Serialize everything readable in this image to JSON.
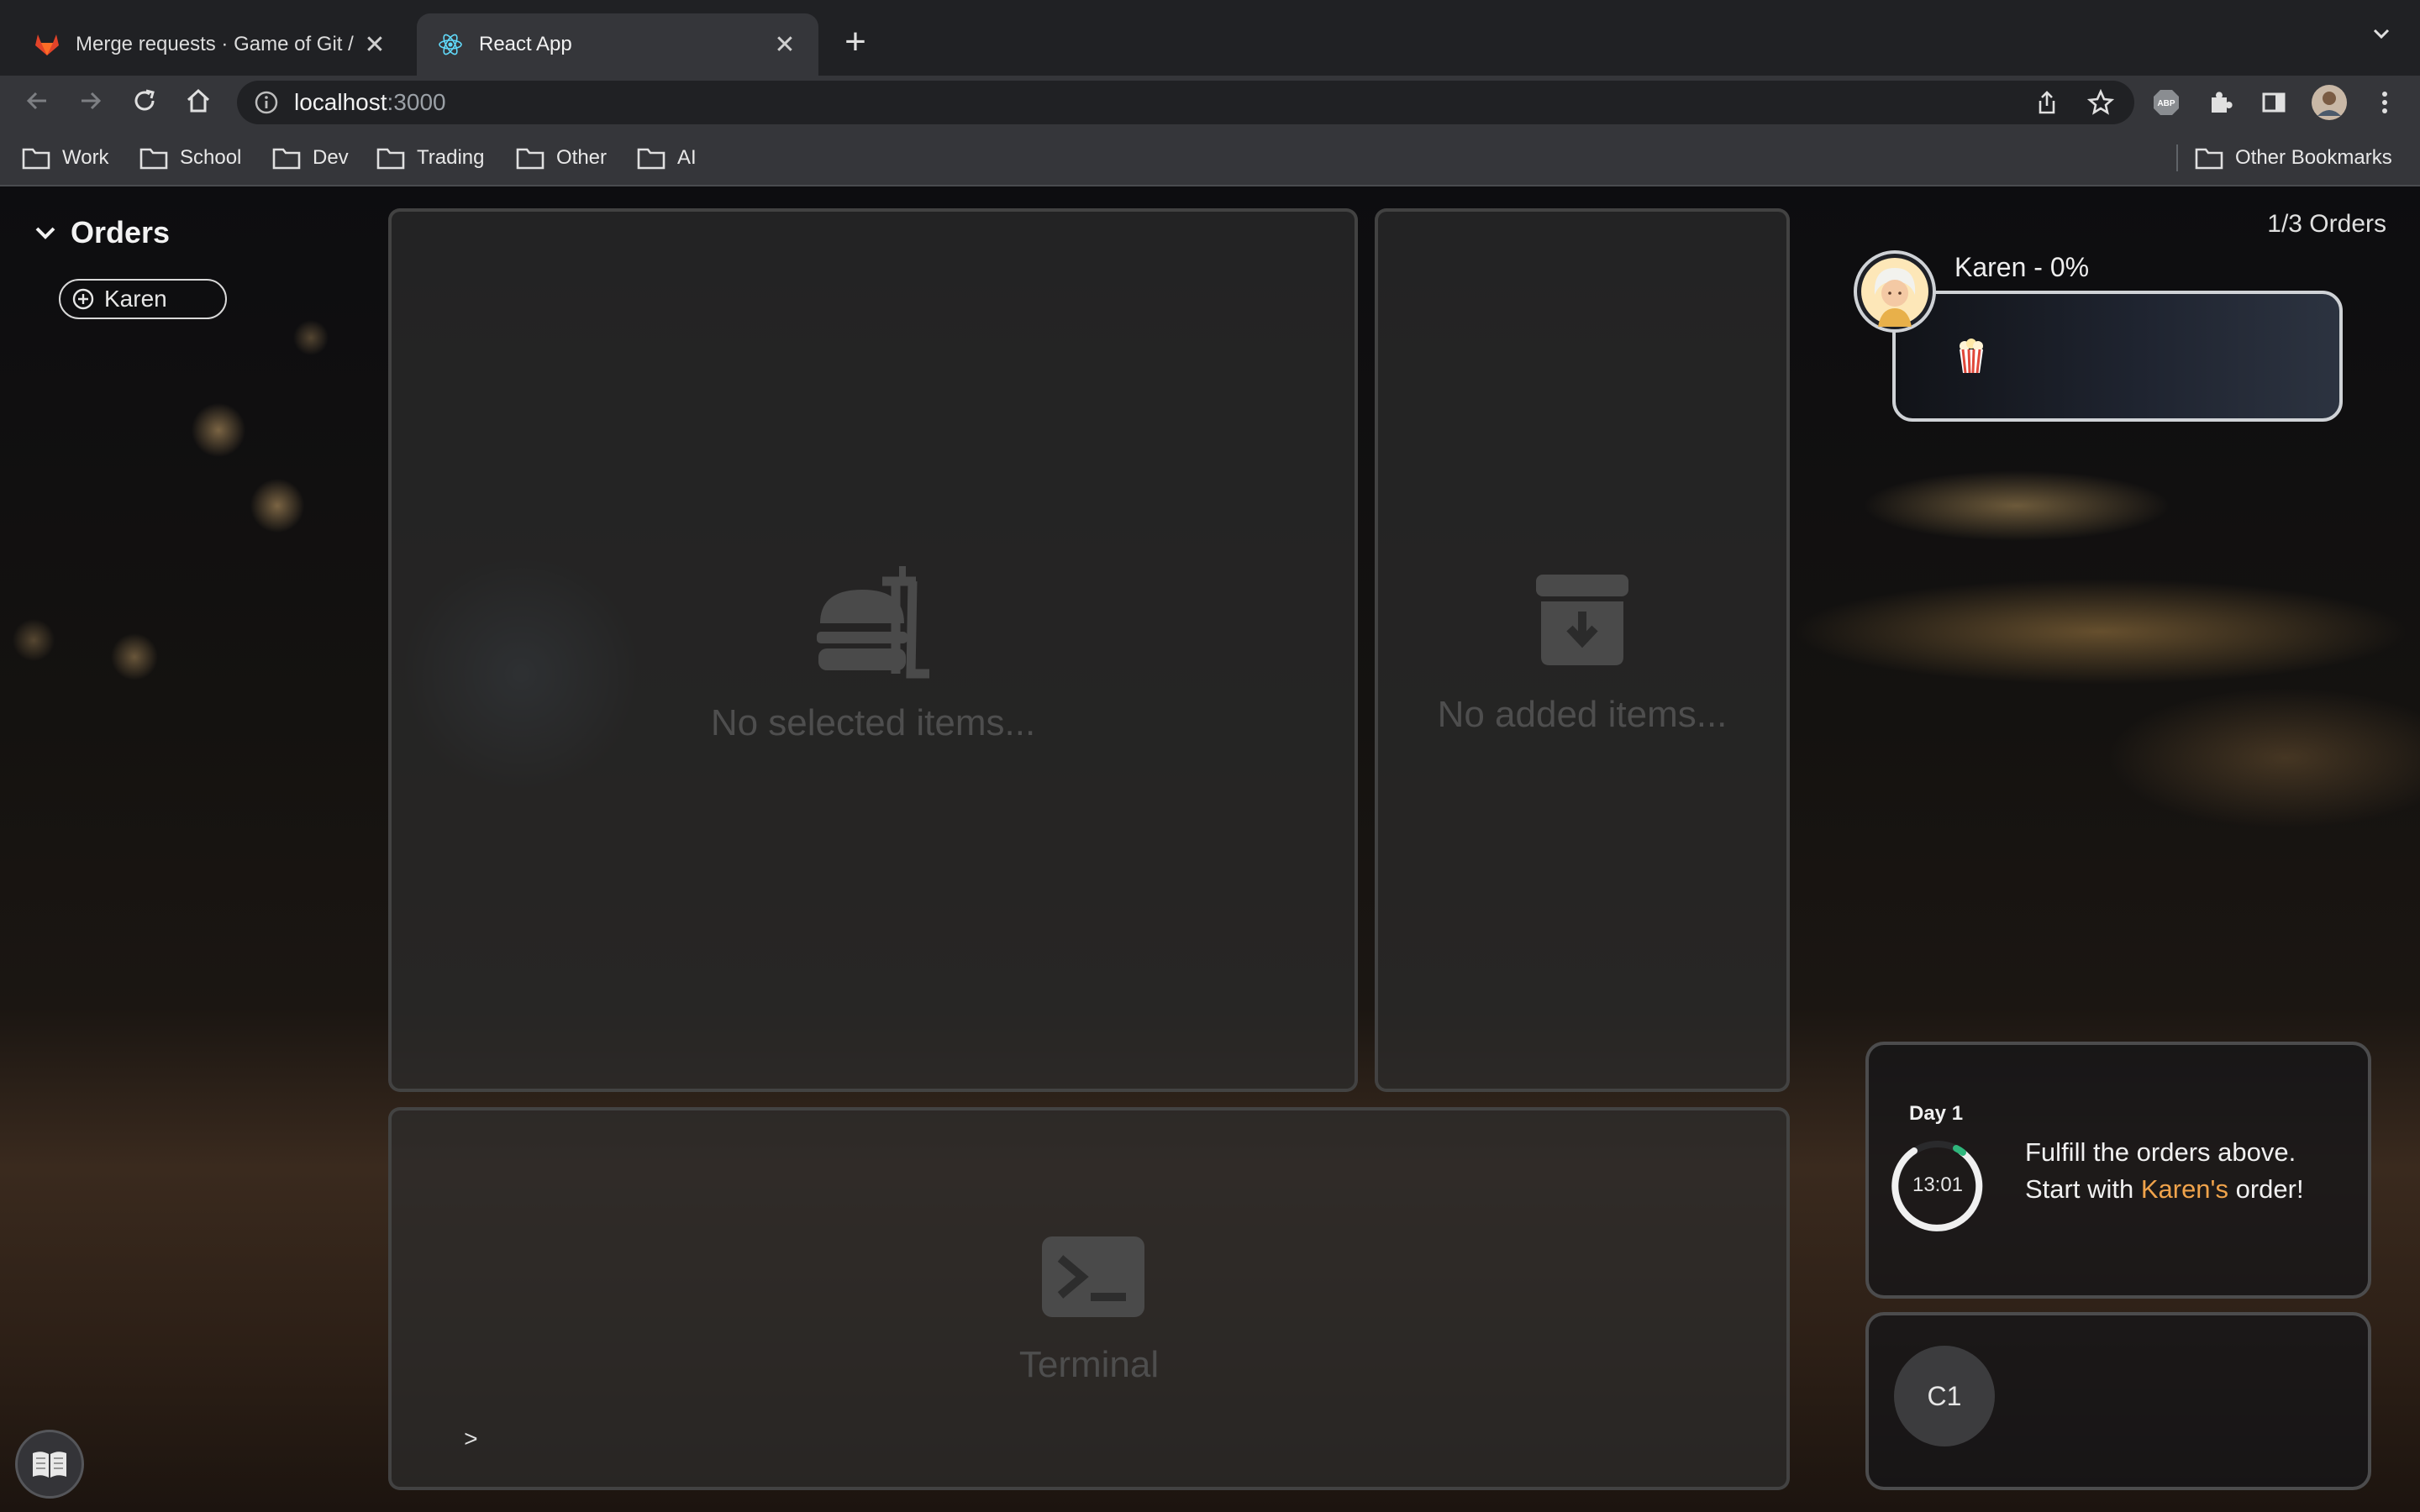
{
  "browser": {
    "tabs": [
      {
        "title": "Merge requests · Game of Git /",
        "favicon": "gitlab-icon",
        "active": false
      },
      {
        "title": "React App",
        "favicon": "react-icon",
        "active": true
      }
    ],
    "close_glyph": "✕",
    "new_tab_glyph": "+",
    "url_host": "localhost",
    "url_port": ":3000",
    "bookmarks": [
      "Work",
      "School",
      "Dev",
      "Trading",
      "Other",
      "AI"
    ],
    "other_bookmarks": "Other Bookmarks"
  },
  "sidebar": {
    "title": "Orders",
    "customer_chip": "Karen"
  },
  "selected_panel": {
    "empty_text": "No selected items...",
    "icon": "food-tray-icon"
  },
  "added_panel": {
    "empty_text": "No added items...",
    "icon": "archive-download-icon"
  },
  "terminal": {
    "label": "Terminal",
    "prompt": ">",
    "icon": "terminal-icon"
  },
  "orders": {
    "count_label": "1/3 Orders",
    "current": {
      "name": "Karen - 0%",
      "progress_percent": 0,
      "item_icon": "popcorn-icon"
    }
  },
  "day": {
    "label": "Day 1",
    "timer": "13:01",
    "line1": "Fulfill the orders above.",
    "line2_prefix": "Start with ",
    "line2_highlight": "Karen's",
    "line2_suffix": " order!",
    "highlight_color": "#f0a34b"
  },
  "customer_badge": "C1",
  "colors": {
    "accent_timer": "#2fb67c",
    "chrome_dark": "#202124",
    "chrome_toolbar": "#35363a"
  }
}
